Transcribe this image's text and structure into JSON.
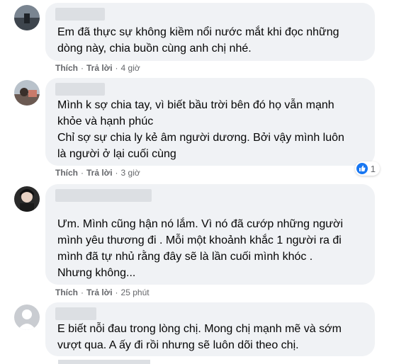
{
  "comments": [
    {
      "text": "Em đã thực sự không kiềm nổi nước mắt khi đọc những\ndòng này, chia buồn cùng anh chị nhé.",
      "like_label": "Thích",
      "reply_label": "Trả lời",
      "time": "4 giờ"
    },
    {
      "text": "Mình k sợ chia tay, vì biết bầu trời bên đó họ vẫn mạnh\nkhỏe và hạnh phúc\nChỉ sợ sự chia ly kẻ âm người dương. Bởi vậy mình luôn\nlà người ở lại cuối cùng",
      "like_label": "Thích",
      "reply_label": "Trả lời",
      "time": "3 giờ",
      "reaction_count": "1"
    },
    {
      "text": "Ưm. Mình cũng hận nó lắm. Vì nó đã cướp những người\nmình yêu thương đi . Mỗi một khoảnh khắc 1 người ra đi\nmình đã tự nhủ rằng đây sẽ là lần cuối mình khóc .\nNhưng không...",
      "like_label": "Thích",
      "reply_label": "Trả lời",
      "time": "25 phút"
    },
    {
      "text": "E biết nỗi đau trong lòng chị. Mong chị mạnh mẽ và sớm\nvượt qua. A ấy đi rồi nhưng sẽ luôn dõi theo chị."
    }
  ],
  "colors": {
    "bubble": "#f0f2f5",
    "meta_text": "#65676b",
    "body_text": "#050505",
    "like_blue": "#1877f2"
  },
  "icons": [
    "avatar",
    "like-icon"
  ]
}
